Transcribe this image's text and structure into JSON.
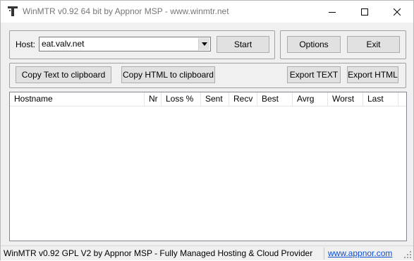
{
  "window": {
    "title": "WinMTR v0.92 64 bit by Appnor MSP - www.winmtr.net",
    "icon": "winmtr-app-icon",
    "controls": [
      "minimize-icon",
      "maximize-icon",
      "close-icon"
    ]
  },
  "host": {
    "label": "Host:",
    "value": "eat.valv.net"
  },
  "buttons": {
    "start": "Start",
    "options": "Options",
    "exit": "Exit",
    "copy_text": "Copy Text to clipboard",
    "copy_html": "Copy HTML to clipboard",
    "export_text": "Export TEXT",
    "export_html": "Export HTML"
  },
  "table": {
    "columns": [
      "Hostname",
      "Nr",
      "Loss %",
      "Sent",
      "Recv",
      "Best",
      "Avrg",
      "Worst",
      "Last"
    ],
    "rows": []
  },
  "status": {
    "text": "WinMTR v0.92 GPL V2 by Appnor MSP - Fully Managed Hosting & Cloud Provider",
    "link": "www.appnor.com"
  },
  "colors": {
    "link": "#0b4fd0",
    "button_face": "#e1e1e1",
    "window_bg": "#f0f0f0"
  }
}
